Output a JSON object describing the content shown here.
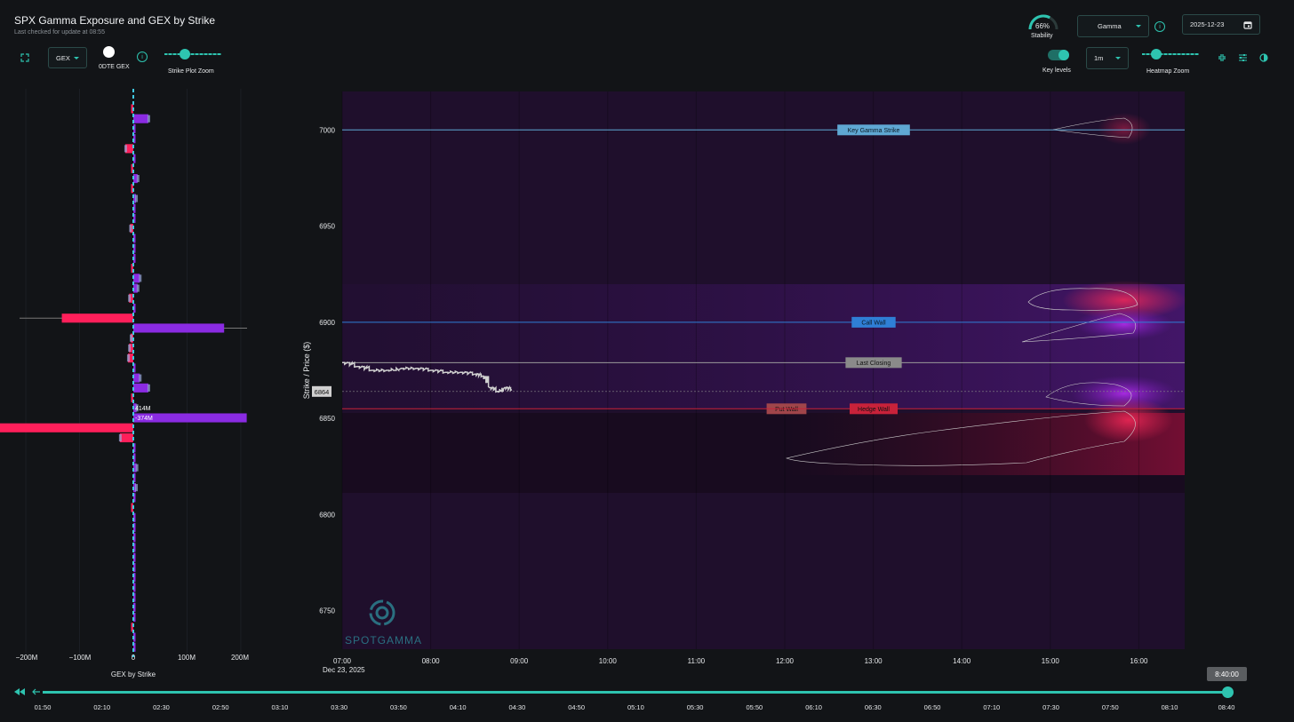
{
  "header": {
    "title": "SPX Gamma Exposure and GEX by Strike",
    "subtitle": "Last checked for update at 08:55"
  },
  "left_controls": {
    "gex_select": "GEX",
    "zero_dte_label": "0DTE GEX",
    "strike_zoom_label": "Strike Plot Zoom"
  },
  "right_controls": {
    "stability_value": "66%",
    "stability_label": "Stability",
    "stability_fraction": 0.66,
    "greek_select": "Gamma",
    "date_value": "2025-12-23",
    "key_levels_label": "Key levels",
    "interval_select": "1m",
    "heatmap_zoom_label": "Heatmap Zoom"
  },
  "colors": {
    "accent": "#2ec4b0",
    "positive_bar": "#8a2be2",
    "negative_bar": "#ff1f5a",
    "call_wall": "#2f7fd6",
    "put_wall": "#a0454a",
    "hedge_wall": "#c8223a",
    "key_gamma": "#5fa8d3",
    "last_closing": "#9a9a9a"
  },
  "gex_chart": {
    "xlabel": "GEX by Strike",
    "x_ticks": [
      "−200M",
      "−100M",
      "0",
      "100M",
      "200M"
    ],
    "bar_label_pos": "414M",
    "bar_label_neg": "-374M"
  },
  "heatmap": {
    "ylabel": "Strike / Price ($)",
    "y_ticks": [
      "7000",
      "6950",
      "6900",
      "6850",
      "6800",
      "6750"
    ],
    "x_ticks": [
      "07:00",
      "08:00",
      "09:00",
      "10:00",
      "11:00",
      "12:00",
      "13:00",
      "14:00",
      "15:00",
      "16:00"
    ],
    "x_sub": "Dec 23, 2025",
    "spot_label": "6864",
    "levels": {
      "key_gamma": "Key Gamma Strike",
      "call_wall": "Call Wall",
      "last_closing": "Last Closing",
      "put_wall": "Put Wall",
      "hedge_wall": "Hedge Wall"
    },
    "watermark": "SPOTGAMMA"
  },
  "timeline": {
    "current_time": "8:40:00",
    "labels": [
      "01:50",
      "02:10",
      "02:30",
      "02:50",
      "03:10",
      "03:30",
      "03:50",
      "04:10",
      "04:30",
      "04:50",
      "05:10",
      "05:30",
      "05:50",
      "06:10",
      "06:30",
      "06:50",
      "07:10",
      "07:30",
      "07:50",
      "08:10",
      "08:40"
    ]
  },
  "chart_data": [
    {
      "type": "bar",
      "title": "",
      "xlabel": "GEX by Strike",
      "ylabel": "",
      "orientation": "horizontal",
      "xlim": [
        -210,
        210
      ],
      "ylim": [
        6730,
        7015
      ],
      "x_ticks": [
        "−200M",
        "−100M",
        "0",
        "100M",
        "200M"
      ],
      "strikes": [
        7005,
        7000,
        6995,
        6990,
        6985,
        6980,
        6975,
        6970,
        6965,
        6960,
        6955,
        6950,
        6945,
        6940,
        6935,
        6930,
        6925,
        6920,
        6915,
        6910,
        6905,
        6900,
        6895,
        6890,
        6885,
        6880,
        6875,
        6870,
        6865,
        6860,
        6855,
        6850,
        6845,
        6840,
        6835,
        6830,
        6825,
        6820,
        6815,
        6810,
        6805,
        6800,
        6795,
        6790,
        6785,
        6780,
        6775,
        6770,
        6765,
        6760,
        6755,
        6750,
        6745,
        6740,
        6735
      ],
      "values": [
        -3,
        28,
        3,
        2,
        -15,
        3,
        -2,
        8,
        -3,
        5,
        4,
        1,
        -6,
        3,
        1,
        2,
        -2,
        12,
        8,
        -8,
        1,
        -133,
        169,
        -5,
        -8,
        -10,
        2,
        12,
        28,
        -4,
        6,
        211,
        -373,
        -25,
        4,
        3,
        6,
        4,
        5,
        2,
        -4,
        1,
        1,
        2,
        1,
        0,
        1,
        1,
        0,
        1,
        0,
        1,
        -3,
        0,
        0
      ],
      "data_labels": [
        {
          "strike": 6855,
          "label": "414M"
        },
        {
          "strike": 6850,
          "label": "-374M"
        }
      ]
    },
    {
      "type": "heatmap",
      "title": "",
      "ylabel": "Strike / Price ($)",
      "xlabel": "",
      "x_ticks": [
        "07:00",
        "08:00",
        "09:00",
        "10:00",
        "11:00",
        "12:00",
        "13:00",
        "14:00",
        "15:00",
        "16:00"
      ],
      "x_sub": "Dec 23, 2025",
      "ylim": [
        6730,
        7020
      ],
      "key_levels": [
        {
          "name": "Key Gamma Strike",
          "value": 7000
        },
        {
          "name": "Call Wall",
          "value": 6900
        },
        {
          "name": "Last Closing",
          "value": 6879
        },
        {
          "name": "Put Wall",
          "value": 6855
        },
        {
          "name": "Hedge Wall",
          "value": 6855
        }
      ],
      "spot": 6864,
      "price_series": {
        "x": [
          "07:00",
          "07:10",
          "07:20",
          "07:30",
          "07:40",
          "07:50",
          "08:00",
          "08:10",
          "08:20",
          "08:30",
          "08:35",
          "08:40",
          "08:45",
          "08:50",
          "08:55"
        ],
        "y": [
          6879,
          6877,
          6875,
          6875,
          6876,
          6876,
          6875,
          6874,
          6874,
          6873,
          6872,
          6866,
          6864,
          6866,
          6865
        ]
      }
    }
  ]
}
